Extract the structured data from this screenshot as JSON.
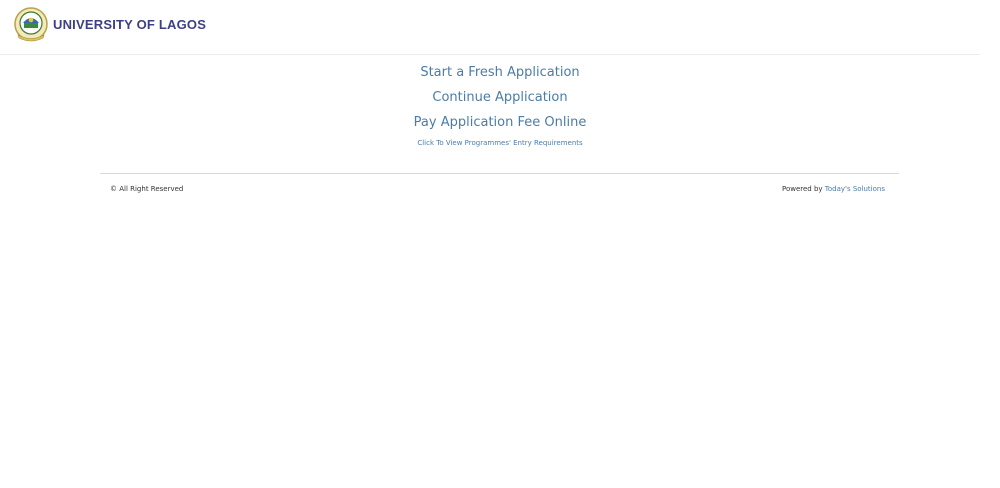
{
  "header": {
    "brand": "UNIVERSITY OF LAGOS",
    "logo_icon": "university-crest-icon"
  },
  "links": {
    "start": "Start a Fresh Application",
    "continue": "Continue Application",
    "pay": "Pay Application Fee Online",
    "requirements": "Click To View Programmes' Entry Requirements"
  },
  "footer": {
    "copyright": "© All Right Reserved",
    "powered_prefix": "Powered by",
    "powered_link": "Today's Solutions"
  },
  "colors": {
    "link": "#4b7ca8",
    "brand": "#3d3f86"
  }
}
